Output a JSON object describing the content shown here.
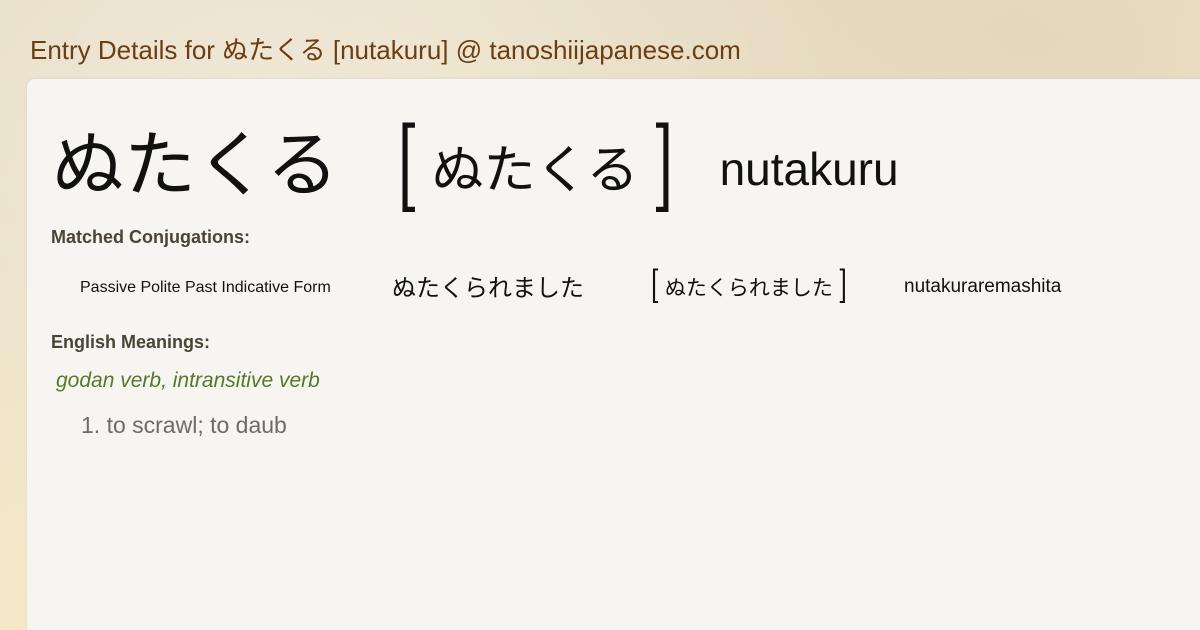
{
  "header": {
    "title": "Entry Details for ぬたくる [nutakuru] @ tanoshiijapanese.com"
  },
  "entry": {
    "word": "ぬたくる",
    "reading": "ぬたくる",
    "romaji": "nutakuru",
    "open_bracket": "[",
    "close_bracket": "]"
  },
  "conjugations": {
    "heading": "Matched Conjugations:",
    "rows": [
      {
        "label": "Passive Polite Past Indicative Form",
        "word": "ぬたくられました",
        "reading": "ぬたくられました",
        "romaji": "nutakuraremashita"
      }
    ]
  },
  "meanings": {
    "heading": "English Meanings:",
    "part_of_speech": "godan verb, intransitive verb",
    "items": [
      "1. to scrawl; to daub"
    ]
  },
  "colors": {
    "header_text": "#6b3e14",
    "card_background": "#f6f5f1",
    "heading_text": "#494437",
    "pos_text": "#55782a",
    "meaning_text": "#6b6b6b"
  }
}
